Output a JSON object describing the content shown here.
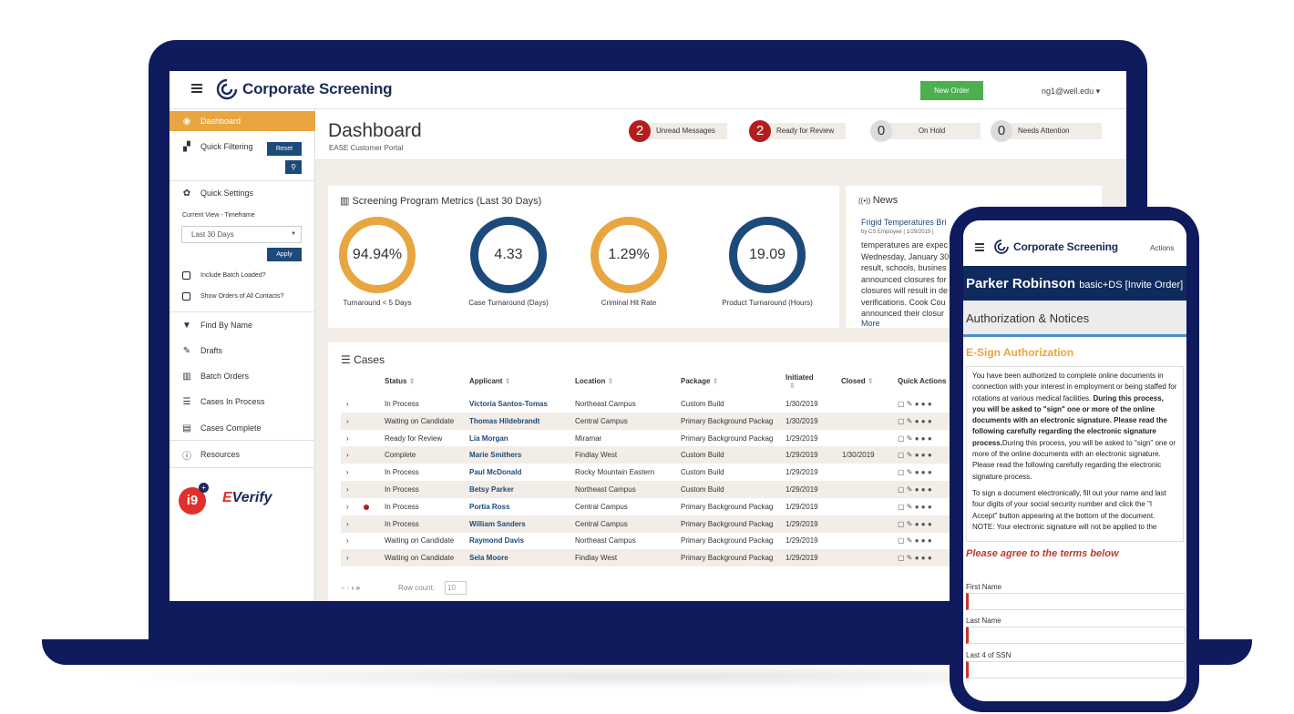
{
  "header": {
    "brand": "Corporate Screening",
    "new_order": "New Order",
    "user": "ng1@well.edu ▾"
  },
  "sidebar": {
    "dashboard": "Dashboard",
    "quick_filtering": "Quick Filtering",
    "reset": "Reset",
    "quick_settings": "Quick Settings",
    "timeframe_label": "Current View - Timeframe",
    "timeframe_value": "Last 30 Days",
    "apply": "Apply",
    "include_batch": "Include Batch Loaded?",
    "show_orders": "Show Orders of All Contacts?",
    "find_by_name": "Find By Name",
    "drafts": "Drafts",
    "batch_orders": "Batch Orders",
    "cases_in_process": "Cases In Process",
    "cases_complete": "Cases Complete",
    "resources": "Resources",
    "i9": "i9",
    "everify_e": "E",
    "everify_rest": "Verify"
  },
  "page": {
    "title": "Dashboard",
    "subtitle": "EASE Customer Portal"
  },
  "badges": [
    {
      "count": "2",
      "label": "Unread Messages"
    },
    {
      "count": "2",
      "label": "Ready for Review"
    },
    {
      "count": "0",
      "label": "On Hold"
    },
    {
      "count": "0",
      "label": "Needs Attention"
    }
  ],
  "metrics": {
    "title": "Screening Program Metrics (Last 30 Days)",
    "items": [
      {
        "value": "94.94%",
        "label": "Turnaround < 5 Days",
        "color": "#e8a540"
      },
      {
        "value": "4.33",
        "label": "Case Turnaround (Days)",
        "color": "#1c4a7a"
      },
      {
        "value": "1.29%",
        "label": "Criminal Hit Rate",
        "color": "#e8a540"
      },
      {
        "value": "19.09",
        "label": "Product Turnaround (Hours)",
        "color": "#1c4a7a"
      }
    ]
  },
  "news": {
    "title": "News",
    "headline": "Frigid Temperatures Bri",
    "byline": "by CS Employee | 1/29/2019 |",
    "body": "temperatures are expec Wednesday, January 30 result, schools, busines announced closures for closures will result in de verifications. Cook Cou announced their closur",
    "more": "More"
  },
  "cases": {
    "title": "Cases",
    "columns": [
      "Status",
      "Applicant",
      "Location",
      "Package",
      "Initiated",
      "Closed",
      "Quick Actions"
    ],
    "rows": [
      {
        "status": "In Process",
        "applicant": "Victoria Santos-Tomas",
        "location": "Northeast Campus",
        "package": "Custom Build",
        "initiated": "1/30/2019",
        "closed": "",
        "flag": false
      },
      {
        "status": "Waiting on Candidate",
        "applicant": "Thomas Hildebrandt",
        "location": "Central Campus",
        "package": "Primary Background Packag",
        "initiated": "1/30/2019",
        "closed": "",
        "flag": false
      },
      {
        "status": "Ready for Review",
        "applicant": "Lia Morgan",
        "location": "Miramar",
        "package": "Primary Background Packag",
        "initiated": "1/29/2019",
        "closed": "",
        "flag": false
      },
      {
        "status": "Complete",
        "applicant": "Marie Smithers",
        "location": "Findlay West",
        "package": "Custom Build",
        "initiated": "1/29/2019",
        "closed": "1/30/2019",
        "flag": false
      },
      {
        "status": "In Process",
        "applicant": "Paul McDonald",
        "location": "Rocky Mountain Eastern",
        "package": "Custom Build",
        "initiated": "1/29/2019",
        "closed": "",
        "flag": false
      },
      {
        "status": "In Process",
        "applicant": "Betsy Parker",
        "location": "Northeast Campus",
        "package": "Custom Build",
        "initiated": "1/29/2019",
        "closed": "",
        "flag": false
      },
      {
        "status": "In Process",
        "applicant": "Portia Ross",
        "location": "Central Campus",
        "package": "Primary Background Packag",
        "initiated": "1/29/2019",
        "closed": "",
        "flag": true
      },
      {
        "status": "In Process",
        "applicant": "William Sanders",
        "location": "Central Campus",
        "package": "Primary Background Packag",
        "initiated": "1/29/2019",
        "closed": "",
        "flag": false
      },
      {
        "status": "Waiting on Candidate",
        "applicant": "Raymond Davis",
        "location": "Northeast Campus",
        "package": "Primary Background Packag",
        "initiated": "1/29/2019",
        "closed": "",
        "flag": false
      },
      {
        "status": "Waiting on Candidate",
        "applicant": "Sela Moore",
        "location": "Findlay West",
        "package": "Primary Background Packag",
        "initiated": "1/29/2019",
        "closed": "",
        "flag": false
      }
    ],
    "row_count_label": "Row count:",
    "row_count_value": "10"
  },
  "mobile": {
    "brand": "Corporate Screening",
    "actions": "Actions",
    "name": "Parker Robinson",
    "order": "basic+DS [Invite Order]",
    "section": "Authorization & Notices",
    "esign_title": "E-Sign Authorization",
    "doc_p1_a": "You have been authorized to complete online documents in connection with your interest in employment or being staffed for rotations at various medical facilities.",
    "doc_p1_b": "During this process, you will be asked to \"sign\" one or more of the online documents with an electronic signature. Please read the following carefully regarding the electronic signature process.",
    "doc_p1_c": "During this process, you will be asked to \"sign\" one or more of the online documents with an electronic signature. Please read the following carefully regarding the electronic signature process.",
    "doc_p2": "To sign a document electronically, fill out your name and last four digits of your social security number and click the \"I Accept\" button appearing at the bottom of the document. NOTE: Your electronic signature will not be applied to the",
    "agree": "Please agree to the terms below",
    "first_name": "First Name",
    "last_name": "Last Name",
    "ssn": "Last 4 of SSN"
  }
}
